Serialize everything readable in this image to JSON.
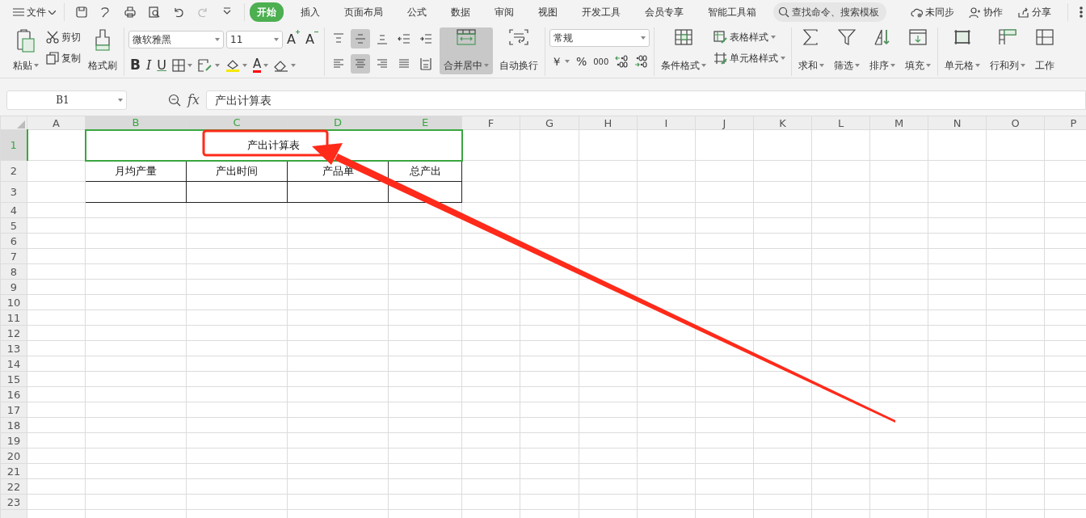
{
  "menu": {
    "file": "文件",
    "tabs": [
      {
        "label": "开始",
        "selected": true
      },
      {
        "label": "插入",
        "selected": false
      },
      {
        "label": "页面布局",
        "selected": false
      },
      {
        "label": "公式",
        "selected": false
      },
      {
        "label": "数据",
        "selected": false
      },
      {
        "label": "审阅",
        "selected": false
      },
      {
        "label": "视图",
        "selected": false
      },
      {
        "label": "开发工具",
        "selected": false
      },
      {
        "label": "会员专享",
        "selected": false
      },
      {
        "label": "智能工具箱",
        "selected": false
      }
    ],
    "search": {
      "placeholder": "查找命令、搜索模板"
    },
    "actions": [
      {
        "kind": "sync",
        "label": "未同步"
      },
      {
        "kind": "share-user",
        "label": "协作"
      },
      {
        "kind": "share",
        "label": "分享"
      }
    ]
  },
  "ribbon": {
    "clipboard": {
      "paste": "粘贴",
      "cut": "剪切",
      "copy": "复制",
      "format_painter": "格式刷"
    },
    "font": {
      "family": "微软雅黑",
      "size": "11"
    },
    "size_buttons": [
      {
        "kind": "grow",
        "label": "A"
      },
      {
        "kind": "shrink",
        "label": "A"
      }
    ],
    "style_buttons": [
      {
        "kind": "bold",
        "label": "B"
      },
      {
        "kind": "italic",
        "label": "I"
      },
      {
        "kind": "underline",
        "label": "U"
      }
    ],
    "font_color": {
      "label": "A",
      "color": "#ff0000"
    },
    "align": [
      {
        "kind": "top",
        "selected": false
      },
      {
        "kind": "middle",
        "selected": true
      },
      {
        "kind": "bottom",
        "selected": false
      },
      {
        "kind": "indent-less",
        "selected": false
      },
      {
        "kind": "indent-more",
        "selected": false
      },
      {
        "kind": "left",
        "selected": false
      },
      {
        "kind": "center",
        "selected": true
      },
      {
        "kind": "right",
        "selected": false
      },
      {
        "kind": "justify",
        "selected": false
      },
      {
        "kind": "distribute",
        "selected": false
      }
    ],
    "merge": {
      "label": "合并居中",
      "selected": true
    },
    "wrap": "自动换行",
    "number_format": "常规",
    "number_buttons": [
      "￥",
      "%",
      "000"
    ],
    "styles": [
      {
        "kind": "conditional",
        "label": "条件格式"
      },
      {
        "kind": "table",
        "label": "表格样式"
      },
      {
        "kind": "cell",
        "label": "单元格样式"
      }
    ],
    "editing": [
      {
        "kind": "sum",
        "label": "求和"
      },
      {
        "kind": "filter",
        "label": "筛选"
      },
      {
        "kind": "sort",
        "label": "排序"
      },
      {
        "kind": "fill",
        "label": "填充"
      }
    ],
    "cells": [
      {
        "kind": "cell",
        "label": "单元格"
      },
      {
        "kind": "rowcol",
        "label": "行和列"
      },
      {
        "kind": "sheet",
        "label": "工作"
      }
    ]
  },
  "formula_bar": {
    "name_box": "B1",
    "fx": "fx",
    "formula": "产出计算表"
  },
  "sheet": {
    "columns": [
      {
        "label": "A",
        "selected": false
      },
      {
        "label": "B",
        "selected": true
      },
      {
        "label": "C",
        "selected": true
      },
      {
        "label": "D",
        "selected": true
      },
      {
        "label": "E",
        "selected": true
      },
      {
        "label": "F",
        "selected": false
      },
      {
        "label": "G",
        "selected": false
      },
      {
        "label": "H",
        "selected": false
      },
      {
        "label": "I",
        "selected": false
      },
      {
        "label": "J",
        "selected": false
      },
      {
        "label": "K",
        "selected": false
      },
      {
        "label": "L",
        "selected": false
      },
      {
        "label": "M",
        "selected": false
      },
      {
        "label": "N",
        "selected": false
      },
      {
        "label": "O",
        "selected": false
      },
      {
        "label": "P",
        "selected": false
      }
    ],
    "rows": [
      {
        "label": "1",
        "selected": true
      },
      {
        "label": "2",
        "selected": false
      },
      {
        "label": "3",
        "selected": false
      },
      {
        "label": "4",
        "selected": false
      },
      {
        "label": "5",
        "selected": false
      },
      {
        "label": "6",
        "selected": false
      },
      {
        "label": "7",
        "selected": false
      },
      {
        "label": "8",
        "selected": false
      },
      {
        "label": "9",
        "selected": false
      },
      {
        "label": "10",
        "selected": false
      },
      {
        "label": "11",
        "selected": false
      },
      {
        "label": "12",
        "selected": false
      },
      {
        "label": "13",
        "selected": false
      },
      {
        "label": "14",
        "selected": false
      },
      {
        "label": "15",
        "selected": false
      },
      {
        "label": "16",
        "selected": false
      },
      {
        "label": "17",
        "selected": false
      },
      {
        "label": "18",
        "selected": false
      },
      {
        "label": "19",
        "selected": false
      },
      {
        "label": "20",
        "selected": false
      },
      {
        "label": "21",
        "selected": false
      },
      {
        "label": "22",
        "selected": false
      },
      {
        "label": "23",
        "selected": false
      }
    ],
    "title": "产出计算表",
    "headers": [
      "月均产量",
      "产出时间",
      "产品单",
      "总产出"
    ]
  }
}
